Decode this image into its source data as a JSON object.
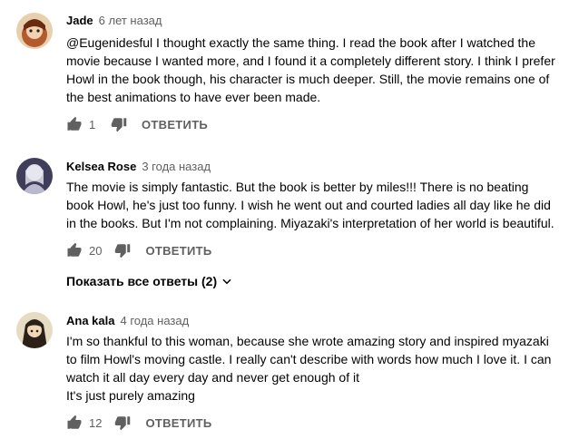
{
  "comments": [
    {
      "author": "Jade",
      "time": "6 лет назад",
      "text": "@Eugenidesful I thought exactly the same thing. I read the book after I watched the movie because I wanted more, and I found it a completely different story. I think I prefer Howl in the book though, his character is much deeper. Still, the movie remains one of the best animations to have ever been made.",
      "likes": "1",
      "reply_label": "ОТВЕТИТЬ",
      "avatar_color": "#c9a27a"
    },
    {
      "author": "Kelsea Rose",
      "time": "3 года назад",
      "text": "The movie is simply fantastic. But the book is better by miles!!! There is no beating book Howl, he's just too funny. I wish he went out and courted ladies all day like he did in the books. But I'm not complaining. Miyazaki's interpretation of her world is beautiful.",
      "likes": "20",
      "reply_label": "ОТВЕТИТЬ",
      "show_replies": "Показать все ответы (2)",
      "avatar_color": "#4a4a66"
    },
    {
      "author": "Ana kala",
      "time": "4 года назад",
      "text": "I'm so thankful to this woman, because she wrote amazing story and inspired myazaki to film Howl's moving castle. I really can't describe with words how much I love it. I can watch it all day every day and never get enough of it\nIt's just purely amazing",
      "likes": "12",
      "reply_label": "ОТВЕТИТЬ",
      "avatar_color": "#d8c9a8"
    }
  ],
  "icons": {
    "like": "thumb-up-icon",
    "dislike": "thumb-down-icon",
    "expand": "chevron-down-icon"
  },
  "colors": {
    "text": "#030303",
    "secondary": "#606060"
  }
}
